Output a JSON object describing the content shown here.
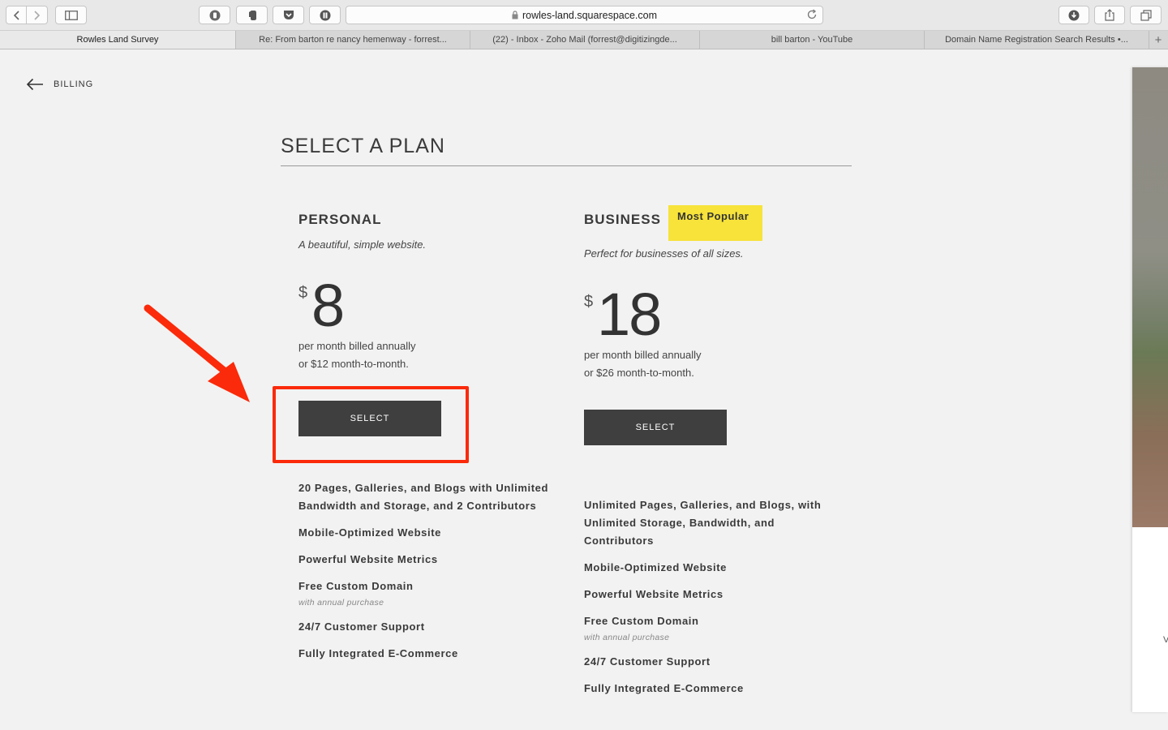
{
  "browser": {
    "url": "rowles-land.squarespace.com",
    "tabs": [
      {
        "label": "Rowles Land Survey",
        "active": true
      },
      {
        "label": "Re: From barton re nancy hemenway - forrest...",
        "active": false
      },
      {
        "label": "(22) - Inbox - Zoho Mail (forrest@digitizingde...",
        "active": false
      },
      {
        "label": "bill barton - YouTube",
        "active": false
      },
      {
        "label": "Domain Name Registration Search Results •...",
        "active": false
      }
    ]
  },
  "page": {
    "back_label": "BILLING",
    "heading": "SELECT A PLAN"
  },
  "plans": [
    {
      "name": "PERSONAL",
      "tagline": "A beautiful, simple website.",
      "currency": "$",
      "price": "8",
      "billing_line1": "per month billed annually",
      "billing_line2": "or $12 month-to-month.",
      "select_label": "SELECT",
      "features": [
        {
          "text": "20 Pages, Galleries, and Blogs with Unlimited Bandwidth and Storage, and 2 Contributors"
        },
        {
          "text": "Mobile-Optimized Website"
        },
        {
          "text": "Powerful Website Metrics"
        },
        {
          "text": "Free Custom Domain",
          "note": "with annual purchase"
        },
        {
          "text": "24/7 Customer Support"
        },
        {
          "text": "Fully Integrated E-Commerce"
        }
      ]
    },
    {
      "name": "BUSINESS",
      "badge": "Most Popular",
      "tagline": "Perfect for businesses of all sizes.",
      "currency": "$",
      "price": "18",
      "billing_line1": "per month billed annually",
      "billing_line2": "or $26 month-to-month.",
      "select_label": "SELECT",
      "features": [
        {
          "text": "Unlimited Pages, Galleries, and Blogs, with Unlimited Storage, Bandwidth, and Contributors"
        },
        {
          "text": "Mobile-Optimized Website"
        },
        {
          "text": "Powerful Website Metrics"
        },
        {
          "text": "Free Custom Domain",
          "note": "with annual purchase"
        },
        {
          "text": "24/7 Customer Support"
        },
        {
          "text": "Fully Integrated E-Commerce"
        }
      ]
    }
  ],
  "side_panel": {
    "partial_text": "V"
  },
  "colors": {
    "accent_badge": "#f7e33a",
    "annotation_red": "#fb2a0a",
    "button_dark": "#3f3f3f"
  }
}
